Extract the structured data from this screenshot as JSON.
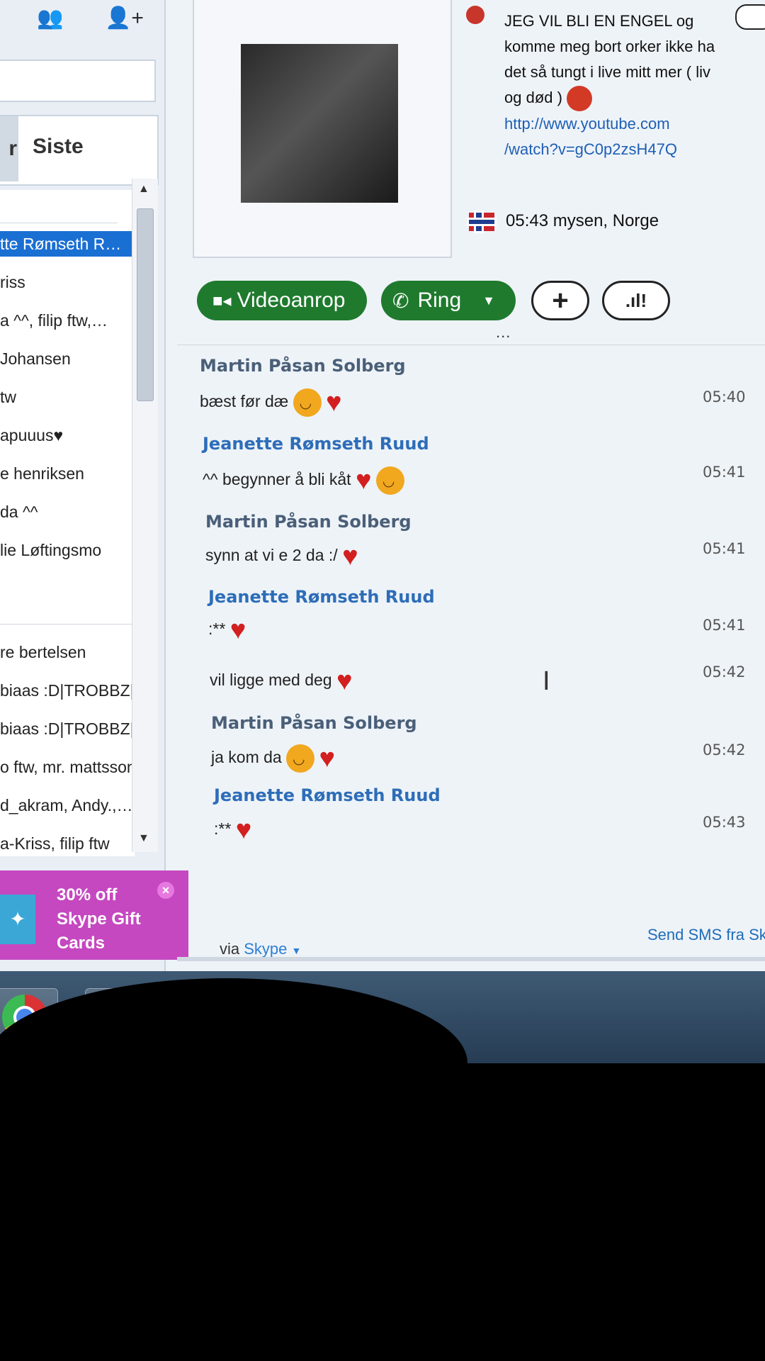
{
  "left_panel": {
    "contacts_icon": "contacts-icon",
    "add_contact_icon": "add-contact-icon",
    "tabs": {
      "left_tab": "r",
      "recent": "Siste"
    },
    "contacts": [
      "tte Rømseth R…",
      "riss",
      "a ^^, filip ftw,…",
      "Johansen",
      "tw",
      "apuuus♥",
      "e henriksen",
      "da ^^",
      "lie Løftingsmo",
      "re bertelsen",
      "biaas :D|TROBBZ|…",
      "biaas :D|TROBBZ|…",
      "o ftw, mr. mattsson",
      "d_akram, Andy.,…",
      "a-Kriss, filip ftw"
    ],
    "promo": {
      "line1": "30% off",
      "line2": "Skype Gift",
      "line3": "Cards",
      "close": "×"
    }
  },
  "profile": {
    "mood_text": "JEG VIL BLI EN ENGEL og komme meg bort orker ikke ha det så tungt i live mitt mer ( liv og død )",
    "link_line1": "http://www.youtube.com",
    "link_line2": "/watch?v=gC0p2zsH47Q",
    "local_time": "05:43 mysen, Norge"
  },
  "call_buttons": {
    "video": "Videoanrop",
    "call": "Ring",
    "add": "+",
    "signal": ".ıl!",
    "more": "..."
  },
  "messages": [
    {
      "sender": "Martin Påsan Solberg",
      "text": "bæst før dæ",
      "time": "05:40"
    },
    {
      "sender": "Jeanette Rømseth Ruud",
      "text": "^^ begynner å bli kåt",
      "time": "05:41"
    },
    {
      "sender": "Martin Påsan Solberg",
      "text": "synn at vi e 2 da :/",
      "time": "05:41"
    },
    {
      "sender": "Jeanette Rømseth Ruud",
      "text": ":**",
      "time": "05:41"
    },
    {
      "sender": "",
      "text": "vil ligge med deg",
      "time": "05:42"
    },
    {
      "sender": "Martin Påsan Solberg",
      "text": "ja kom da",
      "time": "05:42"
    },
    {
      "sender": "Jeanette Rømseth Ruud",
      "text": ":**",
      "time": "05:43"
    }
  ],
  "footer": {
    "via": "via",
    "via_service": "Skype",
    "send_sms": "Send SMS fra Sk"
  },
  "colors": {
    "skype_green": "#1f7a2e",
    "selection_blue": "#1a6fd3",
    "promo_magenta": "#c548c0",
    "heart_red": "#d21f1f",
    "sender_blue": "#2d6db8"
  }
}
